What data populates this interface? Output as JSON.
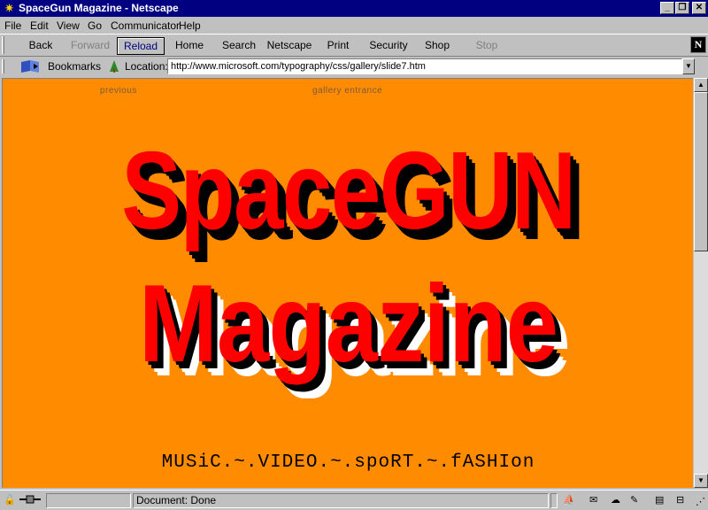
{
  "window": {
    "title": "SpaceGun Magazine - Netscape",
    "minimize_glyph": "_",
    "restore_glyph": "❐",
    "close_glyph": "✕"
  },
  "menu": [
    "File",
    "Edit",
    "View",
    "Go",
    "Communicator",
    "Help"
  ],
  "toolbar": {
    "back": "Back",
    "forward": "Forward",
    "reload": "Reload",
    "home": "Home",
    "search": "Search",
    "netscape": "Netscape",
    "print": "Print",
    "security": "Security",
    "shop": "Shop",
    "stop": "Stop",
    "logo": "N"
  },
  "location": {
    "bookmarks_label": "Bookmarks",
    "location_label": "Location:",
    "url": "http://www.microsoft.com/typography/css/gallery/slide7.htm"
  },
  "page": {
    "previous_link": "previous",
    "gallery_link": "gallery entrance",
    "headline_line1": "SpaceGUN",
    "headline_line2": "Magazine",
    "tagline": "MUSiC.~.VIDEO.~.spoRT.~.fASHIon"
  },
  "status": {
    "text": "Document: Done"
  },
  "icons": {
    "app": "netscape-star-icon",
    "bookmarks": "bookmarks-icon",
    "location": "location-icon",
    "lock": "security-lock-icon",
    "connection": "connection-icon"
  },
  "colors": {
    "page_background": "#ff8c00",
    "headline": "#ff0000",
    "titlebar": "#000080"
  }
}
